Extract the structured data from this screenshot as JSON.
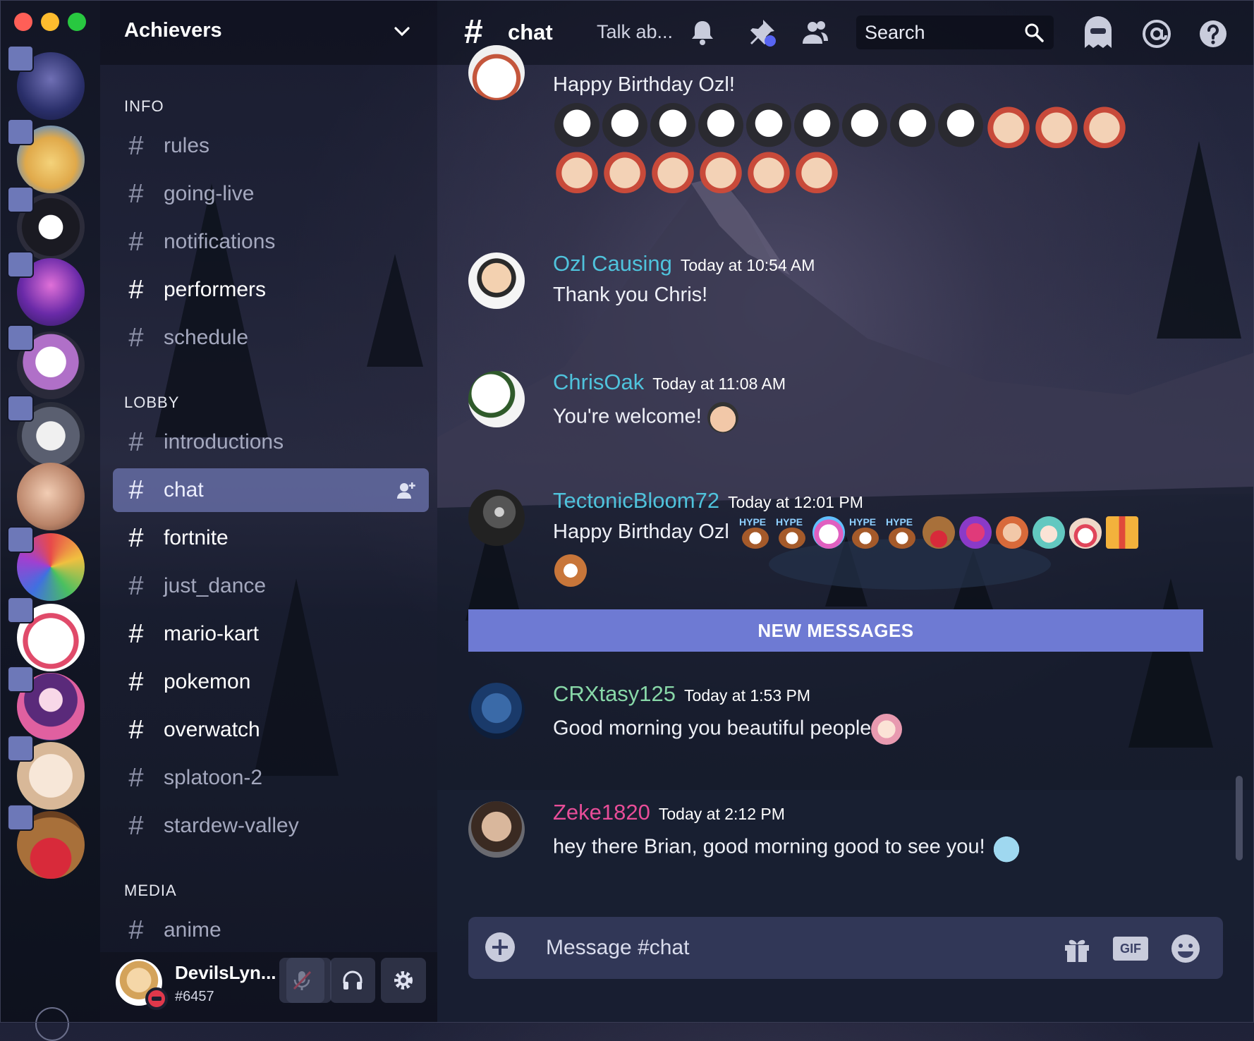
{
  "window": {
    "traffic_lights": [
      "close",
      "minimize",
      "maximize"
    ]
  },
  "guild": {
    "name": "Achievers"
  },
  "categories": {
    "info": "INFO",
    "lobby": "LOBBY",
    "media": "MEDIA"
  },
  "channels": [
    {
      "name": "rules",
      "style": "dim"
    },
    {
      "name": "going-live",
      "style": "dim"
    },
    {
      "name": "notifications",
      "style": "dim"
    },
    {
      "name": "performers",
      "style": "bright"
    },
    {
      "name": "schedule",
      "style": "dim"
    },
    {
      "name": "introductions",
      "style": "dim"
    },
    {
      "name": "chat",
      "style": "active"
    },
    {
      "name": "fortnite",
      "style": "bright"
    },
    {
      "name": "just_dance",
      "style": "dim"
    },
    {
      "name": "mario-kart",
      "style": "bright"
    },
    {
      "name": "pokemon",
      "style": "bright"
    },
    {
      "name": "overwatch",
      "style": "bright"
    },
    {
      "name": "splatoon-2",
      "style": "dim"
    },
    {
      "name": "stardew-valley",
      "style": "dim"
    },
    {
      "name": "anime",
      "style": "dim"
    }
  ],
  "user": {
    "name": "DevilsLyn...",
    "tag": "#6457",
    "status": "dnd"
  },
  "topbar": {
    "hash": "#",
    "channel": "chat",
    "topic": "Talk ab...",
    "search_placeholder": "Search"
  },
  "messages": [
    {
      "text": "Happy Birthday Ozl!"
    },
    {
      "author": "Ozl Causing",
      "color": "#4fc3dc",
      "time": "Today at 10:54 AM",
      "text": "Thank you Chris!"
    },
    {
      "author": "ChrisOak",
      "color": "#4fc3dc",
      "time": "Today at 11:08 AM",
      "text": "You're welcome!"
    },
    {
      "author": "TectonicBloom72",
      "color": "#4fc3dc",
      "time": "Today at 12:01 PM",
      "text": "Happy Birthday Ozl"
    },
    {
      "author": "CRXtasy125",
      "color": "#88d8a8",
      "time": "Today at 1:53 PM",
      "text": "Good morning you beautiful people"
    },
    {
      "author": "Zeke1820",
      "color": "#e84d98",
      "time": "Today at 2:12 PM",
      "text": "hey there Brian, good morning good to see you!"
    }
  ],
  "hype_emote_label": "HYPE",
  "new_messages_label": "NEW MESSAGES",
  "composer": {
    "placeholder": "Message #chat",
    "gif_label": "GIF"
  },
  "icons": [
    "chevron-down-icon",
    "bell-icon",
    "pin-icon",
    "members-icon",
    "search-icon",
    "ghost-icon",
    "mention-icon",
    "help-icon",
    "add-member-icon",
    "mute-mic-icon",
    "headphones-icon",
    "settings-icon",
    "plus-icon",
    "gift-icon",
    "gif-icon",
    "emoji-icon"
  ]
}
